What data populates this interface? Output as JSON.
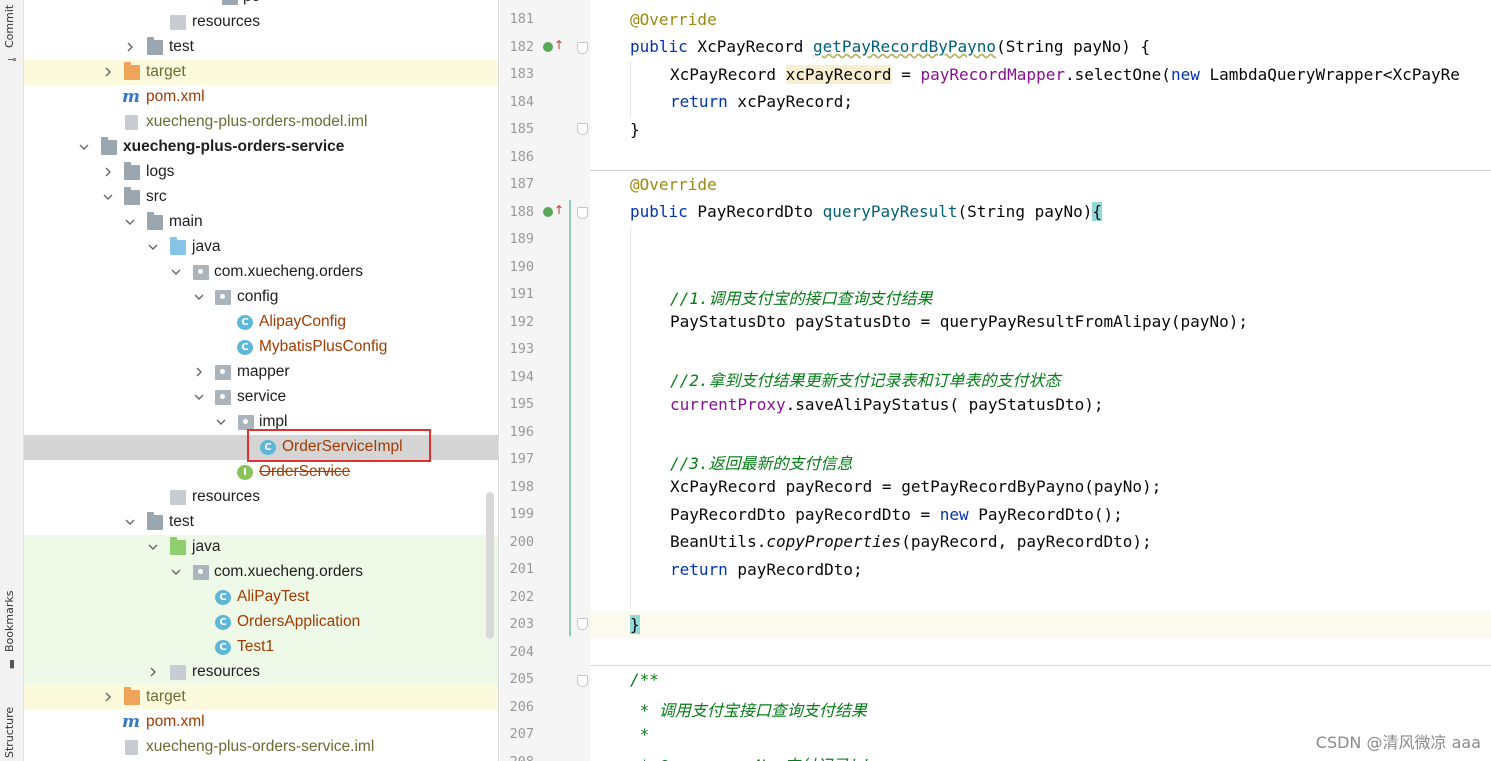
{
  "toolstrip": {
    "commit_label": "Commit",
    "bookmarks_label": "Bookmarks",
    "structure_label": "Structure"
  },
  "tree": {
    "rows": [
      {
        "label": "po",
        "kind": "folder"
      },
      {
        "label": "resources",
        "kind": "resources"
      },
      {
        "label": "test",
        "kind": "folder"
      },
      {
        "label": "target",
        "kind": "folder-orange"
      },
      {
        "label": "pom.xml",
        "kind": "maven"
      },
      {
        "label": "xuecheng-plus-orders-model.iml",
        "kind": "file"
      },
      {
        "label": "xuecheng-plus-orders-service",
        "kind": "module"
      },
      {
        "label": "logs",
        "kind": "folder"
      },
      {
        "label": "src",
        "kind": "folder"
      },
      {
        "label": "main",
        "kind": "folder"
      },
      {
        "label": "java",
        "kind": "folder-blue"
      },
      {
        "label": "com.xuecheng.orders",
        "kind": "package"
      },
      {
        "label": "config",
        "kind": "package"
      },
      {
        "label": "AlipayConfig",
        "kind": "class"
      },
      {
        "label": "MybatisPlusConfig",
        "kind": "class"
      },
      {
        "label": "mapper",
        "kind": "package"
      },
      {
        "label": "service",
        "kind": "package"
      },
      {
        "label": "impl",
        "kind": "package"
      },
      {
        "label": "OrderServiceImpl",
        "kind": "class"
      },
      {
        "label": "OrderService",
        "kind": "interface"
      },
      {
        "label": "resources",
        "kind": "resources"
      },
      {
        "label": "test",
        "kind": "folder"
      },
      {
        "label": "java",
        "kind": "folder-green"
      },
      {
        "label": "com.xuecheng.orders",
        "kind": "package"
      },
      {
        "label": "AliPayTest",
        "kind": "test-class"
      },
      {
        "label": "OrdersApplication",
        "kind": "test-class"
      },
      {
        "label": "Test1",
        "kind": "test-class"
      },
      {
        "label": "resources",
        "kind": "resources"
      },
      {
        "label": "target",
        "kind": "folder-orange"
      },
      {
        "label": "pom.xml",
        "kind": "maven"
      },
      {
        "label": "xuecheng-plus-orders-service.iml",
        "kind": "file"
      }
    ],
    "selected": "OrderServiceImpl"
  },
  "editor": {
    "line_numbers": [
      "181",
      "182",
      "183",
      "184",
      "185",
      "186",
      "187",
      "188",
      "189",
      "190",
      "191",
      "192",
      "193",
      "194",
      "195",
      "196",
      "197",
      "198",
      "199",
      "200",
      "201",
      "202",
      "203",
      "204",
      "205",
      "206",
      "207",
      "208"
    ],
    "code": {
      "l181_ann": "@Override",
      "l182_kw": "public",
      "l182_type": " XcPayRecord ",
      "l182_fn": "getPayRecordByPayno",
      "l182_rest": "(String payNo) {",
      "l183_type": "XcPayRecord ",
      "l183_var": "xcPayRecord",
      "l183_eq": " = ",
      "l183_field": "payRecordMapper",
      "l183_call": ".selectOne(",
      "l183_new": "new",
      "l183_rest": " LambdaQueryWrapper<XcPayRe",
      "l184_kw": "return",
      "l184_rest": " xcPayRecord;",
      "l185": "}",
      "l187_ann": "@Override",
      "l188_kw": "public",
      "l188_type": " PayRecordDto ",
      "l188_fn": "queryPayResult",
      "l188_rest": "(String payNo)",
      "l188_brace": "{",
      "l191_cm": "//1.调用支付宝的接口查询支付结果",
      "l192": "PayStatusDto payStatusDto = queryPayResultFromAlipay(payNo);",
      "l194_cm": "//2.拿到支付结果更新支付记录表和订单表的支付状态",
      "l195_field": "currentProxy",
      "l195_rest": ".saveAliPayStatus( payStatusDto);",
      "l197_cm": "//3.返回最新的支付信息",
      "l198": "XcPayRecord payRecord = getPayRecordByPayno(payNo);",
      "l199_a": "PayRecordDto payRecordDto = ",
      "l199_new": "new",
      "l199_b": " PayRecordDto();",
      "l200_a": "BeanUtils.",
      "l200_fn": "copyProperties",
      "l200_b": "(payRecord, payRecordDto);",
      "l201_kw": "return",
      "l201_rest": " payRecordDto;",
      "l203": "}",
      "l205": "/**",
      "l206": " * 调用支付宝接口查询支付结果",
      "l207": " *",
      "l208": " * @param payNo 支付记录id"
    }
  },
  "watermark": "CSDN @清风微凉 aaa",
  "colors": {
    "keyword": "#0033b3",
    "annotation": "#9e880d",
    "method": "#00627a",
    "field": "#871094",
    "comment": "#067d17",
    "selection_box": "#e03131"
  }
}
